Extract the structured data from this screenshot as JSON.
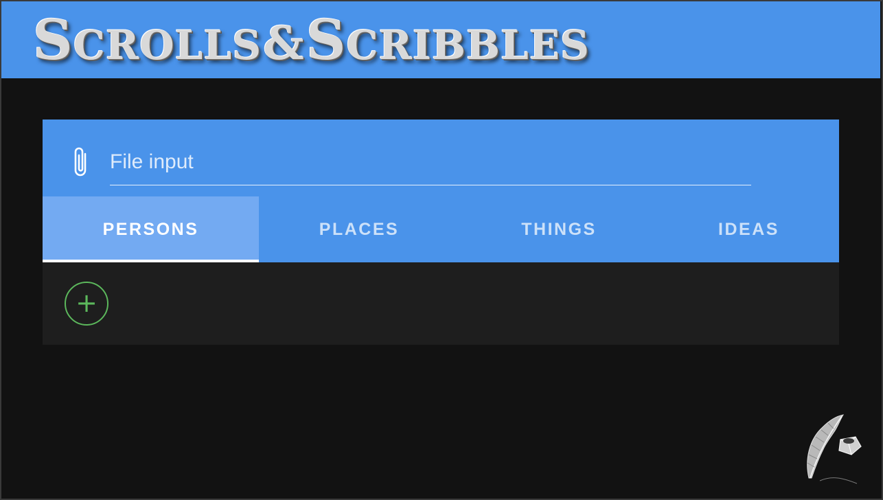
{
  "app": {
    "logo": {
      "word1_initial": "S",
      "word1_rest": "CROLLS",
      "ampersand": "&",
      "word2_initial": "S",
      "word2_rest": "CRIBBLES"
    }
  },
  "file_input": {
    "placeholder": "File input",
    "icon": "paperclip-icon"
  },
  "tabs": [
    {
      "label": "PERSONS",
      "active": true
    },
    {
      "label": "PLACES",
      "active": false
    },
    {
      "label": "THINGS",
      "active": false
    },
    {
      "label": "IDEAS",
      "active": false
    }
  ],
  "add_button": {
    "symbol": "+",
    "icon": "plus-icon"
  },
  "colors": {
    "primary": "#4a93ea",
    "active_tab": "#73aaf2",
    "background": "#121212",
    "panel": "#1e1e1e",
    "add_accent": "#5cb85c"
  },
  "decor": {
    "icon": "quill-inkwell-icon"
  }
}
